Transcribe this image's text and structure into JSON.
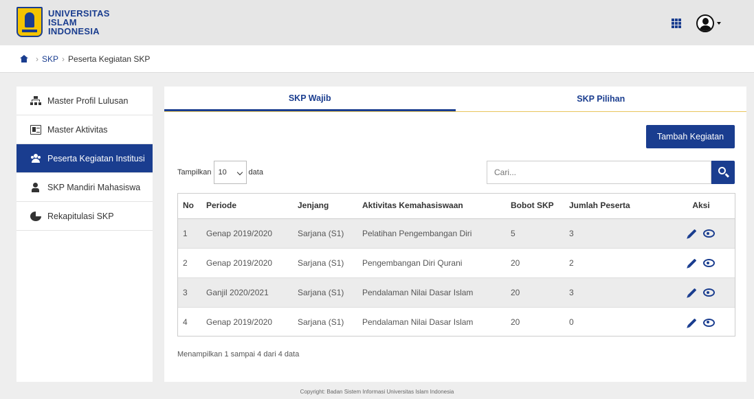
{
  "header": {
    "logo_line1": "UNIVERSITAS",
    "logo_line2": "ISLAM",
    "logo_line3": "INDONESIA",
    "apps_icon": "grid-icon",
    "user_icon": "user-circle-icon"
  },
  "breadcrumb": {
    "home_icon": "home-icon",
    "items": [
      "SKP",
      "Peserta Kegiatan SKP"
    ]
  },
  "sidebar": {
    "items": [
      {
        "label": "Master Profil Lulusan",
        "icon": "sitemap-icon",
        "active": false
      },
      {
        "label": "Master Aktivitas",
        "icon": "id-card-icon",
        "active": false
      },
      {
        "label": "Peserta Kegiatan Institusi",
        "icon": "users-icon",
        "active": true
      },
      {
        "label": "SKP Mandiri Mahasiswa",
        "icon": "user-icon",
        "active": false
      },
      {
        "label": "Rekapitulasi SKP",
        "icon": "pie-chart-icon",
        "active": false
      }
    ]
  },
  "tabs": [
    {
      "label": "SKP Wajib",
      "active": true
    },
    {
      "label": "SKP Pilihan",
      "active": false
    }
  ],
  "toolbar": {
    "add_label": "Tambah Kegiatan",
    "length_prefix": "Tampilkan",
    "length_value": "10",
    "length_suffix": "data",
    "search_placeholder": "Cari..."
  },
  "table": {
    "columns": [
      "No",
      "Periode",
      "Jenjang",
      "Aktivitas Kemahasiswaan",
      "Bobot SKP",
      "Jumlah Peserta",
      "Aksi"
    ],
    "rows": [
      [
        "1",
        "Genap 2019/2020",
        "Sarjana (S1)",
        "Pelatihan Pengembangan Diri",
        "5",
        "3"
      ],
      [
        "2",
        "Genap 2019/2020",
        "Sarjana (S1)",
        "Pengembangan Diri Qurani",
        "20",
        "2"
      ],
      [
        "3",
        "Ganjil 2020/2021",
        "Sarjana (S1)",
        "Pendalaman Nilai Dasar Islam",
        "20",
        "3"
      ],
      [
        "4",
        "Genap 2019/2020",
        "Sarjana (S1)",
        "Pendalaman Nilai Dasar Islam",
        "20",
        "0"
      ]
    ]
  },
  "info_text": "Menampilkan 1 sampai 4 dari 4 data",
  "footer": {
    "copyright": "Copyright: Badan Sistem Informasi Universitas Islam Indonesia"
  },
  "colors": {
    "primary": "#1a3d8f",
    "accent": "#e8c55a"
  }
}
